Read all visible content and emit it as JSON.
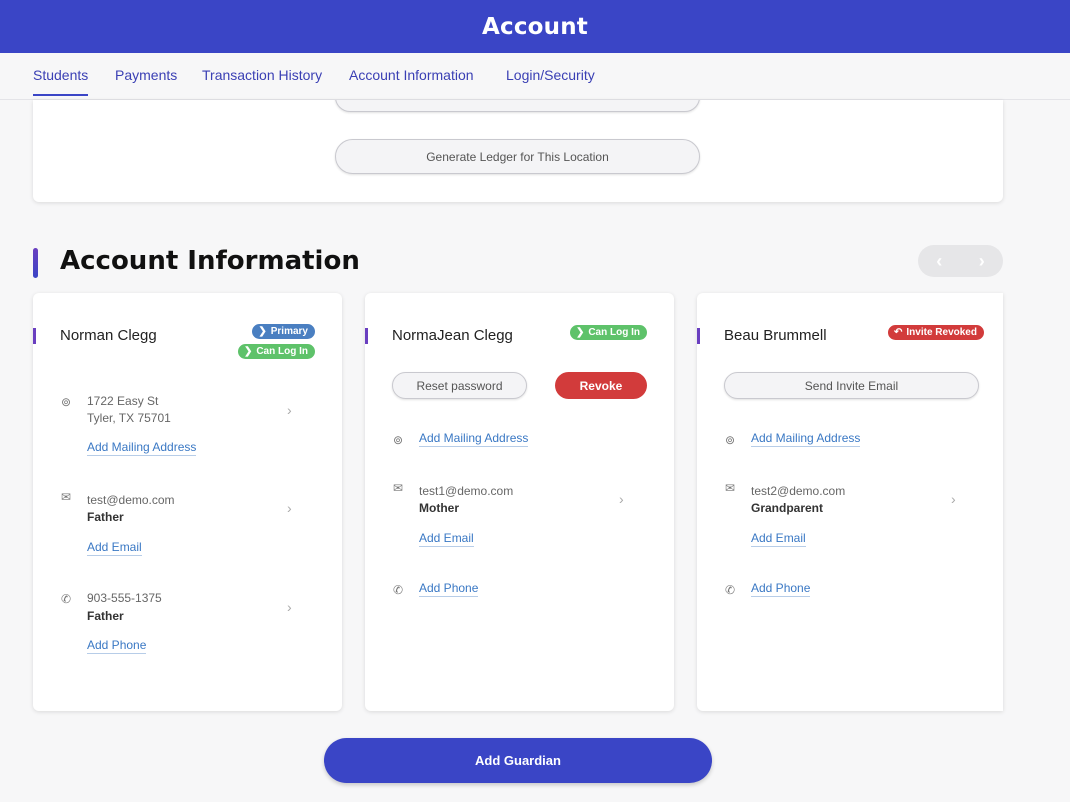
{
  "header": {
    "title": "Account"
  },
  "tabs": [
    {
      "label": "Students"
    },
    {
      "label": "Payments"
    },
    {
      "label": "Transaction History"
    },
    {
      "label": "Account Information"
    },
    {
      "label": "Login/Security"
    }
  ],
  "ledger": {
    "generate_label": "Generate Ledger for This Location"
  },
  "section": {
    "title": "Account Information",
    "prev_icon": "‹",
    "next_icon": "›"
  },
  "guardians": [
    {
      "name": "Norman Clegg",
      "badges": {
        "primary": "Primary",
        "login": "Can Log In"
      },
      "address_line1": "1722 Easy St",
      "address_line2": "Tyler, TX 75701",
      "add_mailing": "Add Mailing Address",
      "email": "test@demo.com",
      "email_relation": "Father",
      "add_email": "Add Email",
      "phone": "903-555-1375",
      "phone_relation": "Father",
      "add_phone": "Add Phone"
    },
    {
      "name": "NormaJean Clegg",
      "badges": {
        "login": "Can Log In"
      },
      "reset_password": "Reset password",
      "revoke": "Revoke",
      "add_mailing": "Add Mailing Address",
      "email": "test1@demo.com",
      "email_relation": "Mother",
      "add_email": "Add Email",
      "add_phone": "Add Phone"
    },
    {
      "name": "Beau Brummell",
      "badges": {
        "revoked": "Invite Revoked"
      },
      "send_invite": "Send Invite Email",
      "add_mailing": "Add Mailing Address",
      "email": "test2@demo.com",
      "email_relation": "Grandparent",
      "add_email": "Add Email",
      "add_phone": "Add Phone"
    }
  ],
  "footer": {
    "add_guardian": "Add Guardian"
  },
  "colors": {
    "brand": "#3a45c6",
    "primary_badge": "#4a7fc1",
    "login_badge": "#5ec26a",
    "revoke": "#d23b3b",
    "link": "#3a78c4"
  }
}
